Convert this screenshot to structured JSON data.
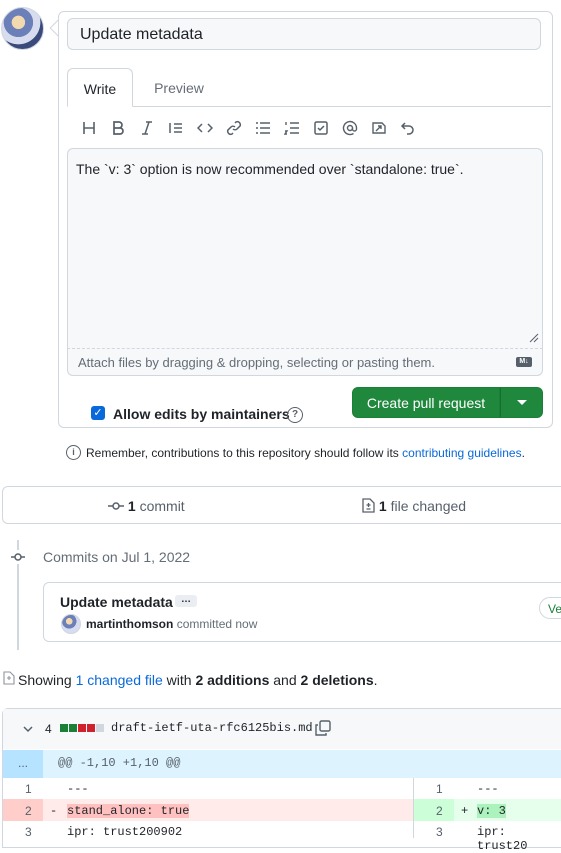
{
  "composer": {
    "title_value": "Update metadata",
    "tabs": [
      "Write",
      "Preview"
    ],
    "body_text": "The `v: 3` option is now recommended over `standalone: true`.",
    "attach_hint": "Attach files by dragging & dropping, selecting or pasting them.",
    "allow_edits_label": "Allow edits by maintainers",
    "allow_edits_checked": true,
    "create_button_label": "Create pull request"
  },
  "toolbar_icons": [
    "heading-icon",
    "bold-icon",
    "italic-icon",
    "quote-icon",
    "code-icon",
    "link-icon",
    "bullet-list-icon",
    "numbered-list-icon",
    "task-list-icon",
    "mention-icon",
    "reference-icon",
    "undo-icon"
  ],
  "contrib_note": {
    "prefix": "Remember, contributions to this repository should follow its",
    "link": "contributing guidelines",
    "suffix": "."
  },
  "stats": {
    "commit_count": "1",
    "commit_label": "commit",
    "files_count": "1",
    "files_label": "file changed"
  },
  "commits": {
    "date_heading": "Commits on Jul 1, 2022",
    "title": "Update metadata",
    "ellipsis": "…",
    "author": "martinthomson",
    "action": "committed now",
    "badge": "Ve"
  },
  "summary": {
    "prefix": "Showing",
    "link": "1 changed file",
    "mid": "with",
    "additions": "2 additions",
    "and": "and",
    "deletions": "2 deletions",
    "end": "."
  },
  "diff": {
    "change_count": "4",
    "file_name": "draft-ietf-uta-rfc6125bis.md",
    "expand_label": "...",
    "hunk": "@@ -1,10 +1,10 @@",
    "rows": [
      {
        "left_num": "1",
        "left_sign": "",
        "left_text": "---",
        "right_num": "1",
        "right_sign": "",
        "right_text": "---"
      },
      {
        "left_num": "2",
        "left_sign": "-",
        "left_text": "stand_alone: true",
        "right_num": "2",
        "right_sign": "+",
        "right_text": "v: 3"
      },
      {
        "left_num": "3",
        "left_sign": "",
        "left_text": "ipr: trust200902",
        "right_num": "3",
        "right_sign": "",
        "right_text": "ipr: trust20"
      }
    ]
  }
}
